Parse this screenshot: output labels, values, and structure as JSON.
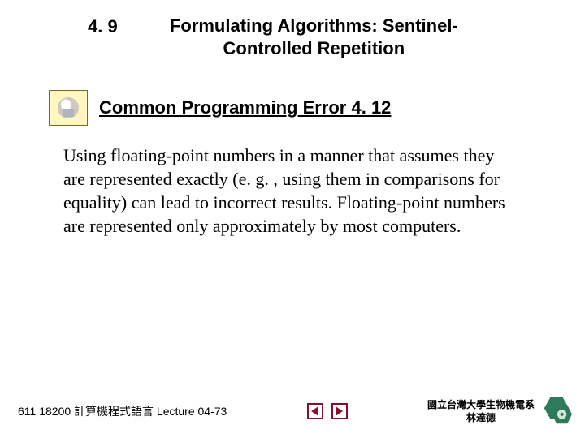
{
  "heading": {
    "section_number": "4. 9",
    "title_line1": "Formulating Algorithms: Sentinel-",
    "title_line2": "Controlled Repetition"
  },
  "tip": {
    "icon_name": "bug-icon",
    "title": "Common Programming Error 4. 12"
  },
  "body": {
    "text": "Using floating-point numbers in a manner that assumes they are represented exactly (e. g. , using them in comparisons for equality) can lead to incorrect results. Floating-point numbers are represented only approximately by most computers."
  },
  "footer": {
    "left": "611 18200 計算機程式語言  Lecture 04-73",
    "right_line1": "國立台灣大學生物機電系",
    "right_line2": "林達德"
  }
}
